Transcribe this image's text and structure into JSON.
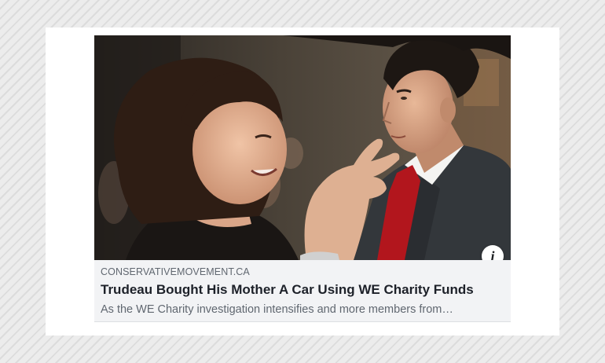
{
  "post": {
    "photo_alt_description": "",
    "info_button_label": "i",
    "link": {
      "domain": "CONSERVATIVEMOVEMENT.CA",
      "headline": "Trudeau Bought His Mother A Car Using WE Charity Funds",
      "description": "As the WE Charity investigation intensifies and more members from…"
    },
    "reactions": [
      {
        "icon": "haha-reaction-icon",
        "color": "#f7b928"
      },
      {
        "icon": "like-reaction-icon",
        "color": "#1877f2"
      },
      {
        "icon": "love-reaction-icon",
        "color": "#f33e58"
      }
    ]
  },
  "colors": {
    "page_background": "#e6e6e6",
    "panel_background": "#ffffff",
    "link_box_background": "#f2f3f5",
    "domain_text": "#606770",
    "headline_text": "#1d2129",
    "description_text": "#606770"
  }
}
